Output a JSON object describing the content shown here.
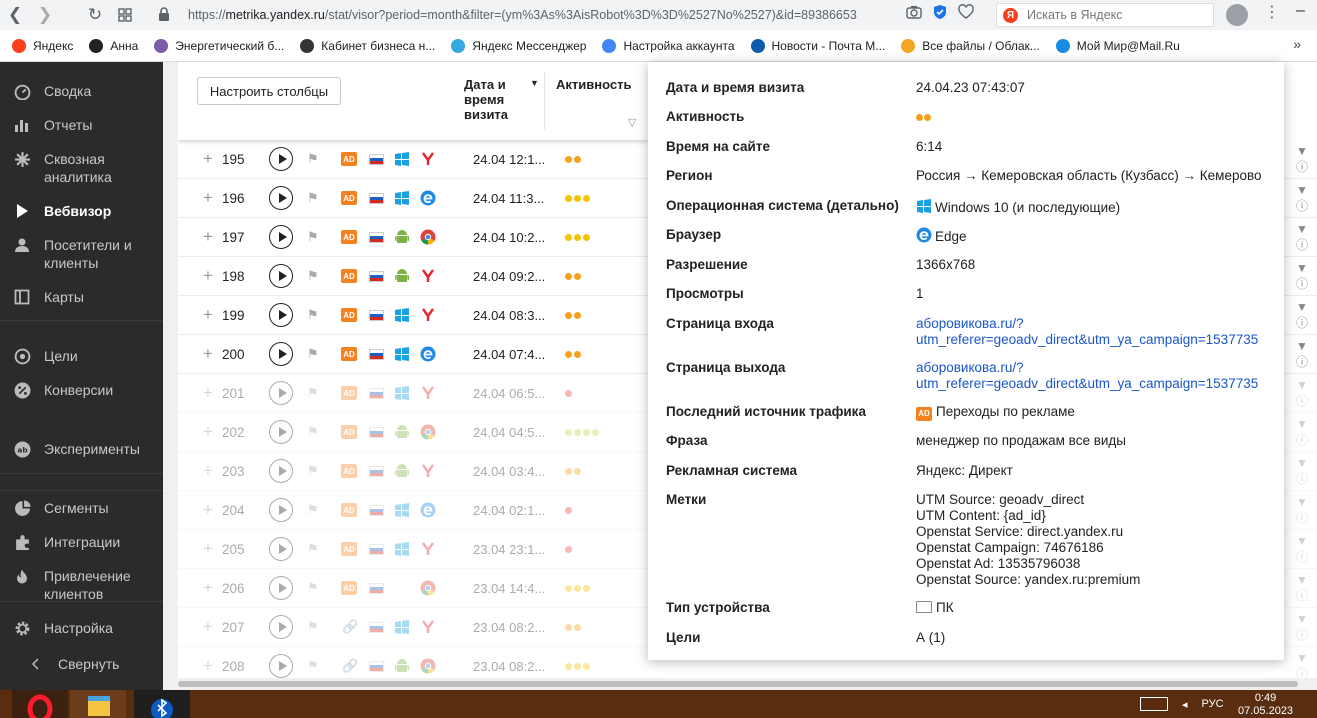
{
  "browser": {
    "url_host": "metrika.yandex.ru",
    "url_prefix": "https://",
    "url_rest": "/stat/visor?period=month&filter=(ym%3As%3AisRobot%3D%3D%2527No%2527)&id=89386653",
    "search_placeholder": "Искать в Яндекс",
    "search_logo": "Я"
  },
  "bookmarks": [
    {
      "label": "Яндекс",
      "color": "#fc3f1d"
    },
    {
      "label": "Анна",
      "color": "#222222"
    },
    {
      "label": "Энергетический б...",
      "color": "#7b5ea7"
    },
    {
      "label": "Кабинет бизнеса н...",
      "color": "#333333"
    },
    {
      "label": "Яндекс Мессенджер",
      "color": "#35a8e0"
    },
    {
      "label": "Настройка аккаунта",
      "color": "#4285f4"
    },
    {
      "label": "Новости - Почта М...",
      "color": "#0b5cad"
    },
    {
      "label": "Все файлы / Облак...",
      "color": "#f5a623"
    },
    {
      "label": "Мой Мир@Mail.Ru",
      "color": "#168de2"
    }
  ],
  "sidebar": {
    "items": [
      {
        "label": "Сводка",
        "icon": "gauge-icon"
      },
      {
        "label": "Отчеты",
        "icon": "bar-chart-icon"
      },
      {
        "label": "Сквозная аналитика",
        "icon": "asterisk-icon"
      },
      {
        "label": "Вебвизор",
        "icon": "play-icon"
      },
      {
        "label": "Посетители и клиенты",
        "icon": "user-icon"
      },
      {
        "label": "Карты",
        "icon": "map-icon"
      },
      {
        "label": "Цели",
        "icon": "target-icon"
      },
      {
        "label": "Конверсии",
        "icon": "percent-icon"
      },
      {
        "label": "Эксперименты",
        "icon": "ab-icon"
      },
      {
        "label": "Сегменты",
        "icon": "pie-icon"
      },
      {
        "label": "Интеграции",
        "icon": "puzzle-icon"
      },
      {
        "label": "Привлечение клиентов",
        "icon": "fire-icon"
      },
      {
        "label": "Настройка",
        "icon": "gear-icon"
      },
      {
        "label": "Свернуть",
        "icon": "chevron-left-icon"
      }
    ]
  },
  "table": {
    "configure_label": "Настроить столбцы",
    "col_date": "Дата и время визита",
    "col_activity": "Активность",
    "rows": [
      {
        "num": "195",
        "date": "24.04 12:1...",
        "src": "ad",
        "os": "windows",
        "browser": "yandex",
        "dots": 2,
        "dot_color": "#f7a11a",
        "dim": false
      },
      {
        "num": "196",
        "date": "24.04 11:3...",
        "src": "ad",
        "os": "windows",
        "browser": "edge",
        "dots": 3,
        "dot_color": "#f5c300",
        "dim": false
      },
      {
        "num": "197",
        "date": "24.04 10:2...",
        "src": "ad",
        "os": "android",
        "browser": "chrome",
        "dots": 3,
        "dot_color": "#f5c300",
        "dim": false
      },
      {
        "num": "198",
        "date": "24.04 09:2...",
        "src": "ad",
        "os": "android",
        "browser": "yandex",
        "dots": 2,
        "dot_color": "#f7a11a",
        "dim": false
      },
      {
        "num": "199",
        "date": "24.04 08:3...",
        "src": "ad",
        "os": "windows",
        "browser": "yandex",
        "dots": 2,
        "dot_color": "#f7a11a",
        "dim": false
      },
      {
        "num": "200",
        "date": "24.04 07:4...",
        "src": "ad",
        "os": "windows",
        "browser": "edge",
        "dots": 2,
        "dot_color": "#f7a11a",
        "dim": false
      },
      {
        "num": "201",
        "date": "24.04 06:5...",
        "src": "ad",
        "os": "windows",
        "browser": "yandex",
        "dots": 1,
        "dot_color": "#e8463c",
        "dim": true
      },
      {
        "num": "202",
        "date": "24.04 04:5...",
        "src": "ad",
        "os": "android",
        "browser": "chrome",
        "dots": 4,
        "dot_color": "#c2d94a",
        "dim": true
      },
      {
        "num": "203",
        "date": "24.04 03:4...",
        "src": "ad",
        "os": "android",
        "browser": "yandex",
        "dots": 2,
        "dot_color": "#f7a11a",
        "dim": true
      },
      {
        "num": "204",
        "date": "24.04 02:1...",
        "src": "ad",
        "os": "windows",
        "browser": "edge",
        "dots": 1,
        "dot_color": "#e8463c",
        "dim": true
      },
      {
        "num": "205",
        "date": "23.04 23:1...",
        "src": "ad",
        "os": "windows",
        "browser": "yandex",
        "dots": 1,
        "dot_color": "#e8463c",
        "dim": true
      },
      {
        "num": "206",
        "date": "23.04 14:4...",
        "src": "ad",
        "os": "apple",
        "browser": "chrome",
        "dots": 3,
        "dot_color": "#f5c300",
        "dim": true
      },
      {
        "num": "207",
        "date": "23.04 08:2...",
        "src": "link",
        "os": "windows",
        "browser": "yandex",
        "dots": 2,
        "dot_color": "#f7a11a",
        "dim": true
      },
      {
        "num": "208",
        "date": "23.04 08:2...",
        "src": "link",
        "os": "android",
        "browser": "chrome",
        "dots": 3,
        "dot_color": "#f5c300",
        "dim": true
      }
    ]
  },
  "popover": {
    "fields": [
      {
        "key": "Дата и время визита",
        "value": "24.04.23 07:43:07"
      },
      {
        "key": "Активность",
        "value": "",
        "type": "dots",
        "dots": 2
      },
      {
        "key": "Время на сайте",
        "value": "6:14"
      },
      {
        "key": "Регион",
        "value": "Россия → Кемеровская область (Кузбасс) → Кемерово"
      },
      {
        "key": "Операционная система (детально)",
        "value": "Windows 10 (и последующие)",
        "type": "win"
      },
      {
        "key": "Браузер",
        "value": "Edge",
        "type": "edge"
      },
      {
        "key": "Разрешение",
        "value": "1366x768"
      },
      {
        "key": "Просмотры",
        "value": "1"
      },
      {
        "key": "Страница входа",
        "value": "aборовикова.ru/?",
        "line2": "utm_referer=geoadv_direct&utm_ya_campaign=1537735",
        "type": "link"
      },
      {
        "key": "Страница выхода",
        "value": "aборовикова.ru/?",
        "line2": "utm_referer=geoadv_direct&utm_ya_campaign=1537735",
        "type": "link"
      },
      {
        "key": "Последний источник трафика",
        "value": "Переходы по рекламе",
        "type": "ad"
      },
      {
        "key": "Фраза",
        "value": "менеджер по продажам все виды"
      },
      {
        "key": "Рекламная система",
        "value": "Яндекс: Директ"
      },
      {
        "key": "Метки",
        "value": "UTM Source: geoadv_direct",
        "extra": [
          "UTM Content: {ad_id}",
          "Openstat Service: direct.yandex.ru",
          "Openstat Campaign: 74676186",
          "Openstat Ad: 13535796038",
          "Openstat Source: yandex.ru:premium"
        ]
      },
      {
        "key": "Тип устройства",
        "value": "ПК",
        "type": "pc"
      },
      {
        "key": "Цели",
        "value": "А (1)"
      }
    ]
  },
  "taskbar": {
    "tray_lang": "РУС",
    "clock_time": "0:49",
    "clock_date": "07.05.2023"
  }
}
